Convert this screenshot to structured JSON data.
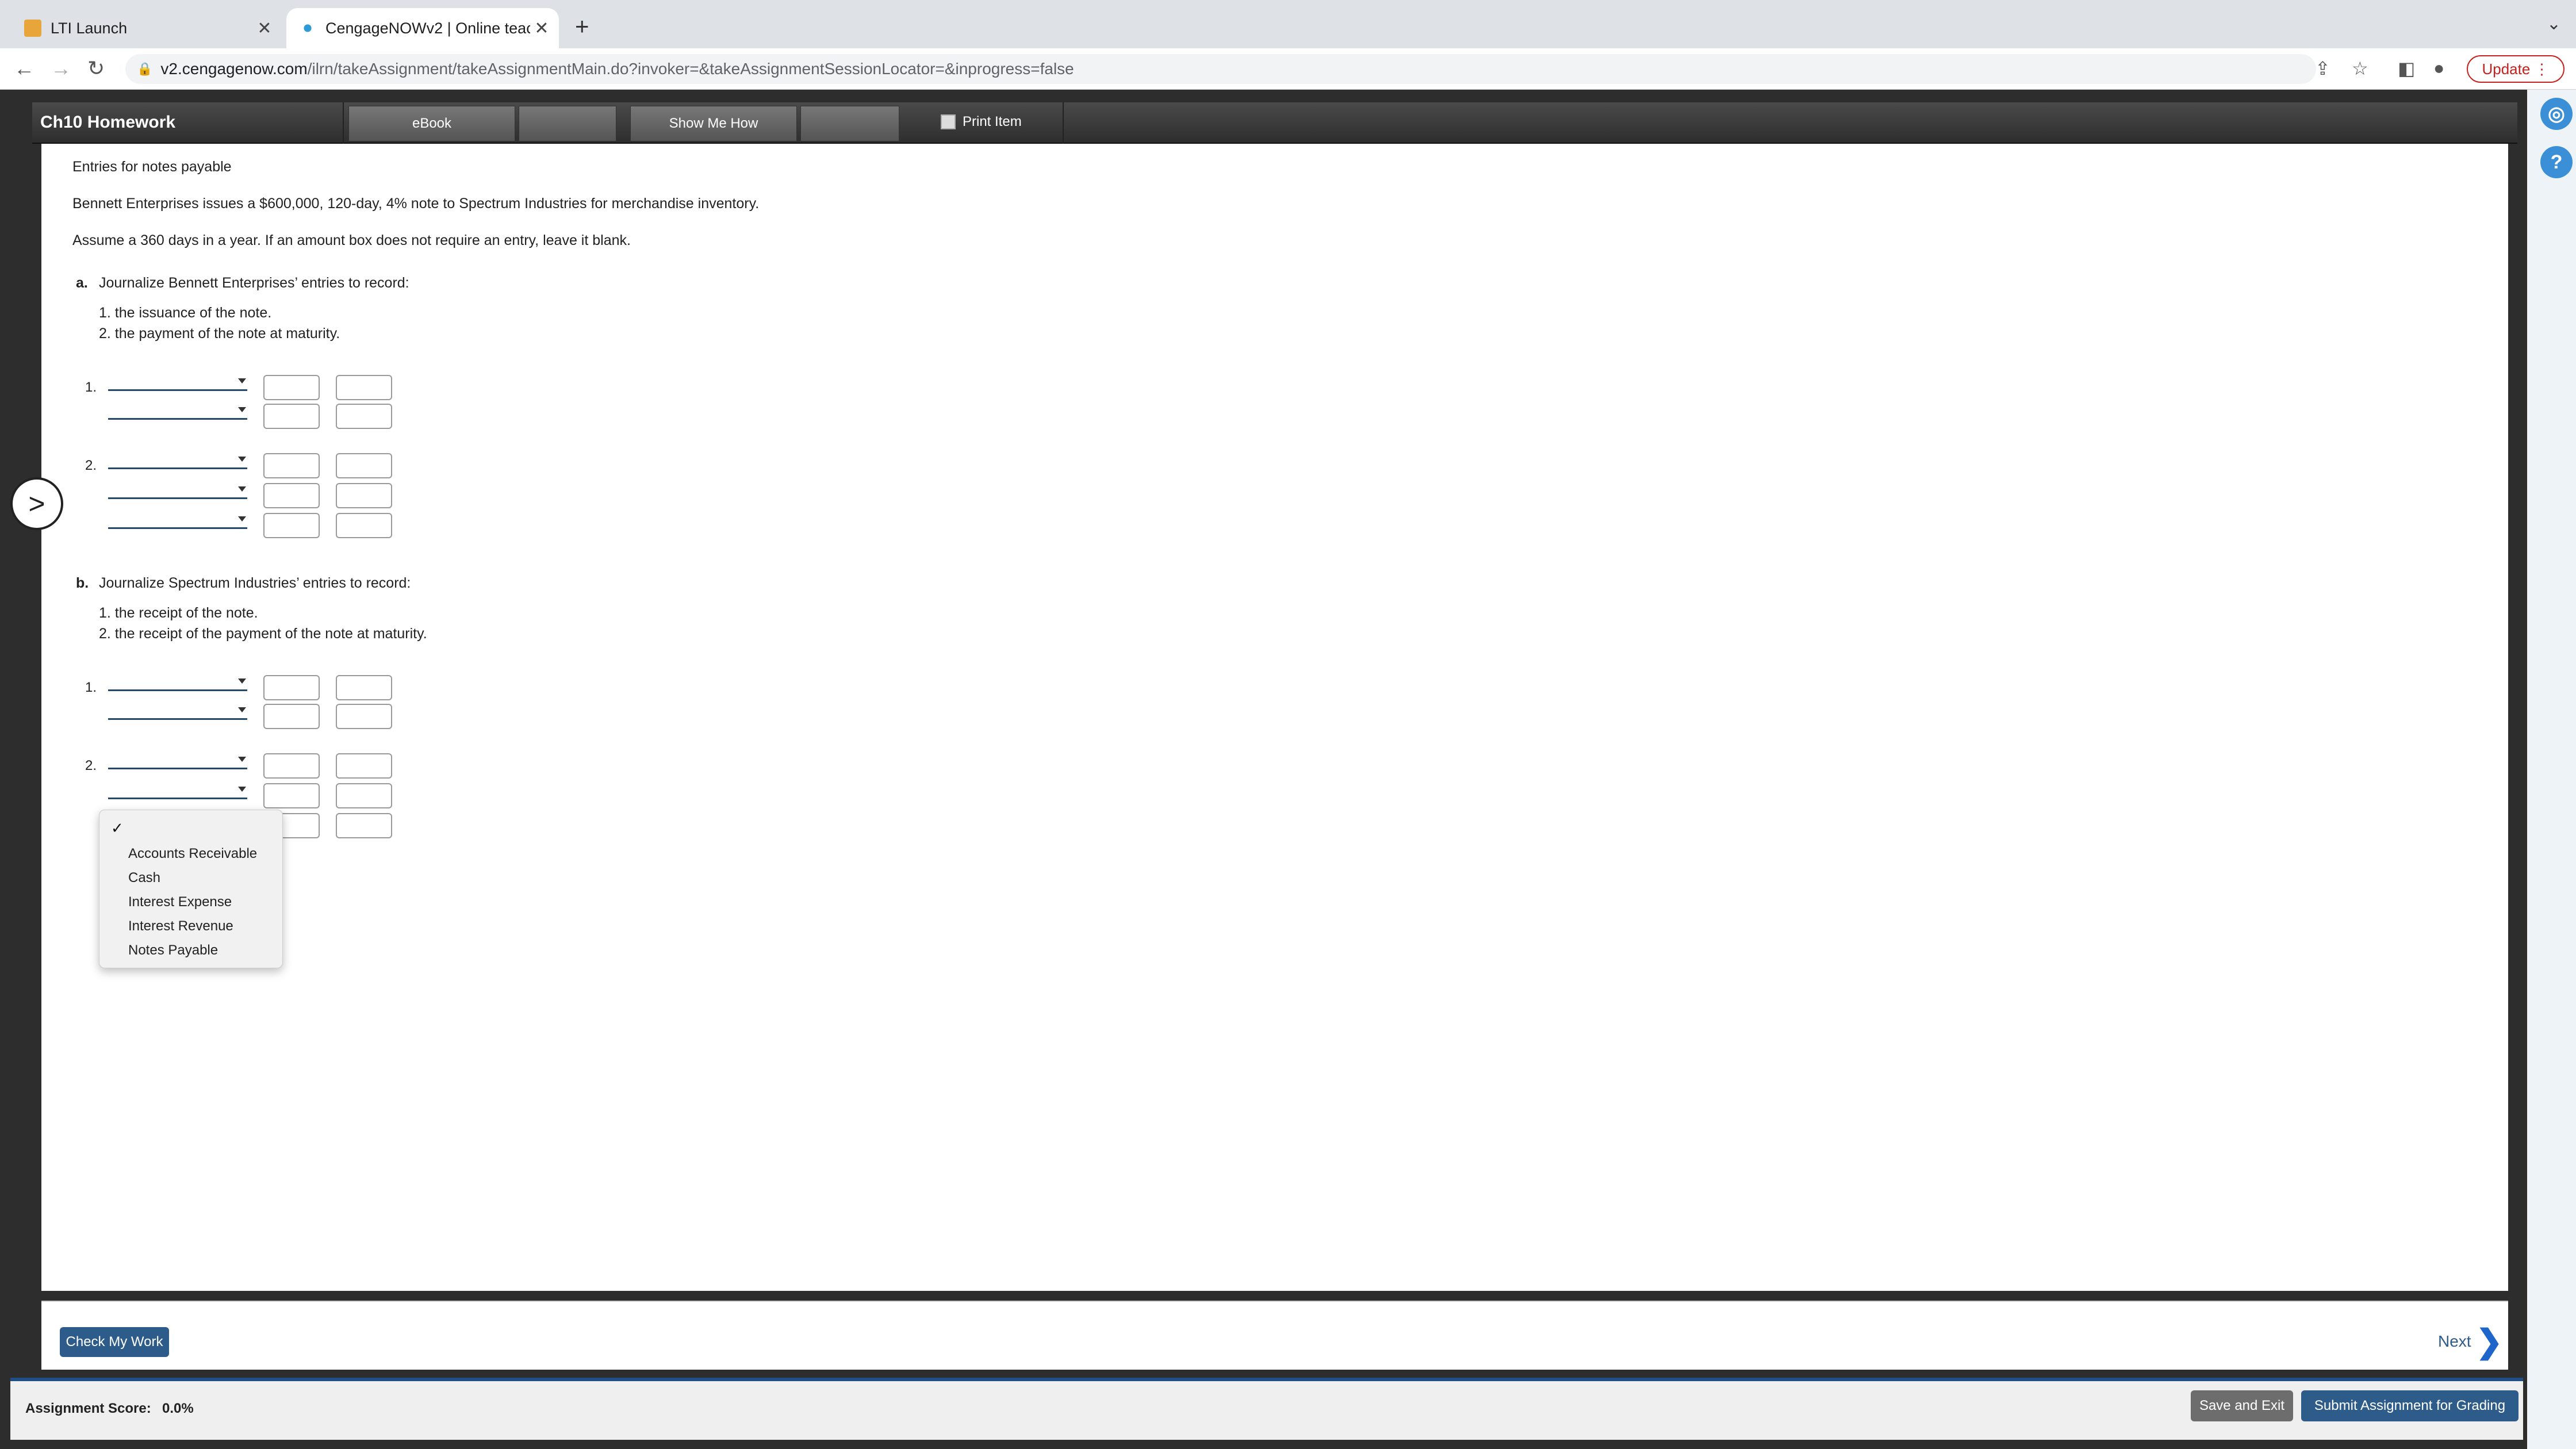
{
  "browser": {
    "tabs": [
      {
        "label": "LTI Launch"
      },
      {
        "label": "CengageNOWv2 | Online teach"
      }
    ],
    "url_host": "v2.cengagenow.com",
    "url_path": "/ilrn/takeAssignment/takeAssignmentMain.do?invoker=&takeAssignmentSessionLocator=&inprogress=false",
    "update_label": "Update"
  },
  "header": {
    "title": "Ch10 Homework",
    "ebook": "eBook",
    "show_me_how": "Show Me How",
    "print_item": "Print Item"
  },
  "problem": {
    "title": "Entries for notes payable",
    "statement": "Bennett Enterprises issues a $600,000, 120-day, 4% note to Spectrum Industries for merchandise inventory.",
    "assumption": "Assume a 360 days in a year. If an amount box does not require an entry, leave it blank.",
    "part_a": {
      "letter": "a.",
      "prompt": "Journalize Bennett Enterprises’ entries to record:",
      "items": [
        "1. the issuance of the note.",
        "2. the payment of the note at maturity."
      ],
      "entry1_label": "1.",
      "entry2_label": "2."
    },
    "part_b": {
      "letter": "b.",
      "prompt": "Journalize Spectrum Industries’ entries to record:",
      "items": [
        "1. the receipt of the note.",
        "2. the receipt of the payment of the note at maturity."
      ],
      "entry1_label": "1.",
      "entry2_label": "2."
    }
  },
  "dropdown": {
    "check": "✓",
    "options": [
      "Accounts Receivable",
      "Cash",
      "Interest Expense",
      "Interest Revenue",
      "Notes Payable"
    ]
  },
  "footer": {
    "check_my_work": "Check My Work",
    "next": "Next",
    "score_label": "Assignment Score:",
    "score_value": "0.0%",
    "save_exit": "Save and Exit",
    "submit": "Submit Assignment for Grading"
  },
  "colors": {
    "accent": "#2e5c8a",
    "header_bg": "#3a3a3a",
    "update_red": "#c5221f"
  }
}
